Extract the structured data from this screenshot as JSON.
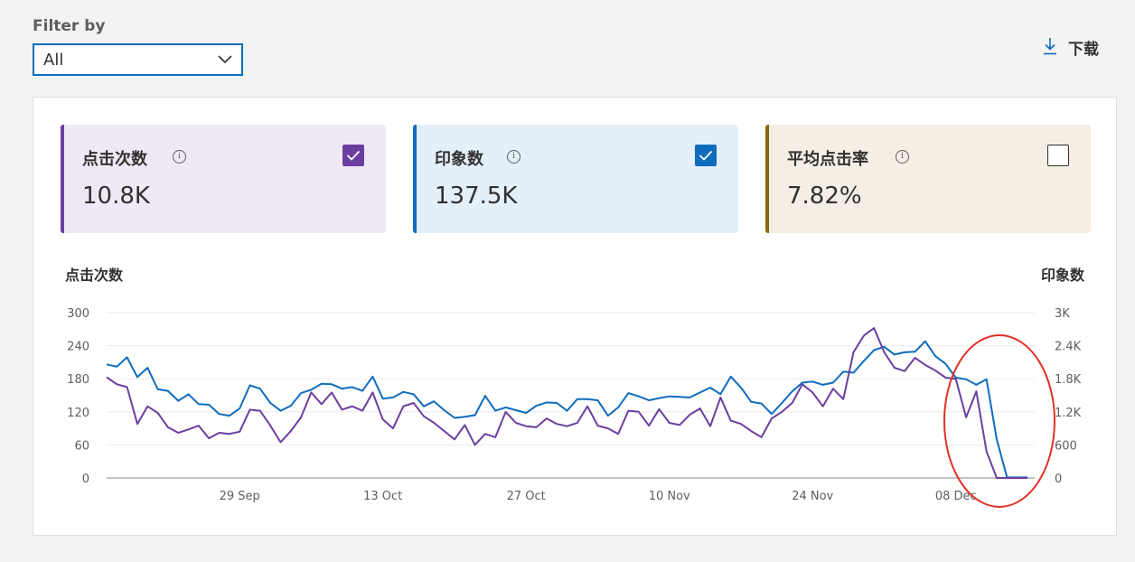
{
  "filter": {
    "label": "Filter by",
    "selected": "All"
  },
  "toolbar": {
    "download_label": "下载"
  },
  "metrics": [
    {
      "title": "点击次数",
      "value": "10.8K",
      "checked": true,
      "color": "#6b3fa0"
    },
    {
      "title": "印象数",
      "value": "137.5K",
      "checked": true,
      "color": "#0f6cbd"
    },
    {
      "title": "平均点击率",
      "value": "7.82%",
      "checked": false,
      "color": "#8a6a0e"
    }
  ],
  "chart_data": {
    "type": "line",
    "y_left_title": "点击次数",
    "y_right_title": "印象数",
    "y_left_ticks": [
      "0",
      "60",
      "120",
      "180",
      "240",
      "300"
    ],
    "y_right_ticks": [
      "0",
      "600",
      "1.2K",
      "1.8K",
      "2.4K",
      "3K"
    ],
    "ylim_left": [
      0,
      300
    ],
    "ylim_right": [
      0,
      3000
    ],
    "x_ticks": [
      {
        "index": 13,
        "label": "29 Sep"
      },
      {
        "index": 27,
        "label": "13 Oct"
      },
      {
        "index": 41,
        "label": "27 Oct"
      },
      {
        "index": 55,
        "label": "10 Nov"
      },
      {
        "index": 69,
        "label": "24 Nov"
      },
      {
        "index": 83,
        "label": "08 Dec"
      }
    ],
    "grid": true,
    "series": [
      {
        "name": "印象数",
        "axis": "right",
        "color": "#0f6cbd",
        "values": [
          2060,
          2020,
          2190,
          1830,
          2000,
          1610,
          1580,
          1400,
          1520,
          1340,
          1330,
          1160,
          1130,
          1260,
          1680,
          1620,
          1360,
          1220,
          1310,
          1540,
          1600,
          1710,
          1700,
          1620,
          1650,
          1580,
          1840,
          1440,
          1460,
          1560,
          1520,
          1300,
          1390,
          1230,
          1090,
          1110,
          1140,
          1490,
          1220,
          1280,
          1230,
          1180,
          1310,
          1370,
          1360,
          1220,
          1430,
          1430,
          1410,
          1130,
          1280,
          1540,
          1480,
          1410,
          1450,
          1480,
          1470,
          1460,
          1550,
          1640,
          1520,
          1840,
          1640,
          1380,
          1350,
          1160,
          1360,
          1570,
          1730,
          1750,
          1690,
          1730,
          1930,
          1910,
          2120,
          2320,
          2380,
          2240,
          2280,
          2290,
          2480,
          2210,
          2070,
          1820,
          1790,
          1690,
          1790,
          700,
          10,
          10,
          10
        ]
      },
      {
        "name": "点击次数",
        "axis": "left",
        "color": "#6b3fa0",
        "values": [
          183,
          170,
          165,
          98,
          130,
          118,
          92,
          82,
          88,
          95,
          72,
          82,
          80,
          84,
          124,
          122,
          95,
          65,
          85,
          110,
          155,
          134,
          155,
          124,
          130,
          122,
          155,
          106,
          90,
          130,
          136,
          112,
          100,
          85,
          70,
          96,
          60,
          80,
          74,
          120,
          100,
          94,
          92,
          108,
          98,
          94,
          100,
          130,
          95,
          90,
          80,
          122,
          120,
          95,
          125,
          100,
          96,
          115,
          126,
          94,
          146,
          104,
          98,
          85,
          74,
          108,
          120,
          136,
          170,
          155,
          130,
          162,
          143,
          228,
          258,
          272,
          228,
          200,
          194,
          218,
          205,
          195,
          182,
          180,
          110,
          157,
          48,
          0,
          0,
          0,
          0
        ]
      }
    ]
  }
}
